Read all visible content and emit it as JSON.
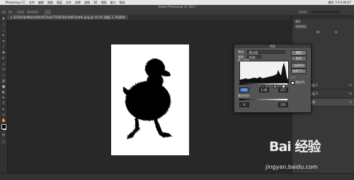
{
  "menubar": {
    "items": [
      "Photoshop CC",
      "文件",
      "编辑",
      "图像",
      "图层",
      "文字",
      "选择",
      "滤镜",
      "3D",
      "视图",
      "窗口",
      "帮助"
    ],
    "clock": "周四 下午3:00:07"
  },
  "window": {
    "title": "Adobe Photoshop CC 2017"
  },
  "document_tab": {
    "label": "4259e5bd98c0c09c4574ae779367b4c0d97ea4fa.png @ 19.1% (图层 1, RGB/8)"
  },
  "levels_dialog": {
    "title": "色阶",
    "preset_label": "预设:",
    "preset_value": "默认值",
    "channel_label": "通道:",
    "channel_value": "RGB",
    "input_label": "输入色阶:",
    "input_black": "155",
    "input_gamma": "1.00",
    "input_white": "217",
    "output_label": "输出色阶:",
    "output_black": "0",
    "output_white": "255",
    "ok_label": "确定",
    "cancel_label": "取消",
    "auto_label": "自动(A)",
    "options_label": "选项(T)...",
    "preview_label": "预览(P)"
  },
  "properties_panel": {
    "title": "属性",
    "subtitle": "像素图层",
    "w_label": "W:",
    "h_label": "H:"
  },
  "layers": [
    {
      "name": "图层 1",
      "fx": "fx"
    },
    {
      "name": "图层 0",
      "fx": "fx"
    },
    {
      "name": "背景",
      "fx": "fx"
    }
  ],
  "watermark": {
    "logo": "Bai 经验",
    "url": "jingyan.baidu.com"
  },
  "colors": {
    "ui_dark": "#282828",
    "panel": "#383838",
    "dialog": "#535353",
    "highlight": "#3d6fd1"
  }
}
